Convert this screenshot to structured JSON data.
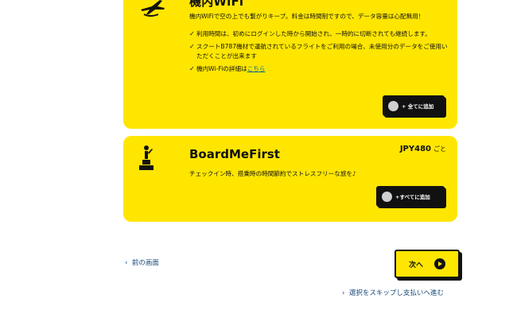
{
  "wifi": {
    "title": "機内WiFi",
    "description": "機内WiFiで空の上でも繋がりキープ。料金は時間制ですので、データ容量は心配無用！",
    "bullets": [
      "利用時間は、初めにログインした時から開始され、一時的に切断されても継続します。",
      "スクートB787機材で運航されているフライトをご利用の場合、未使用分のデータをご使用いただくことが出来ます"
    ],
    "details_prefix": "機内Wi-Fiの詳細は",
    "details_link": "こちら",
    "add_label": "+ 全てに追加"
  },
  "boardmefirst": {
    "title": "BoardMeFirst",
    "price": "JPY480",
    "price_unit": "ごと",
    "description": "チェックイン時、搭乗時の時間節約でストレスフリーな旅を♪",
    "add_label": "+すべてに追加"
  },
  "nav": {
    "back_label": "前の画面",
    "next_label": "次へ",
    "skip_label": "選択をスキップし支払いへ進む"
  },
  "colors": {
    "accent": "#ffe600",
    "dark": "#111111",
    "link": "#1a4b7a"
  }
}
